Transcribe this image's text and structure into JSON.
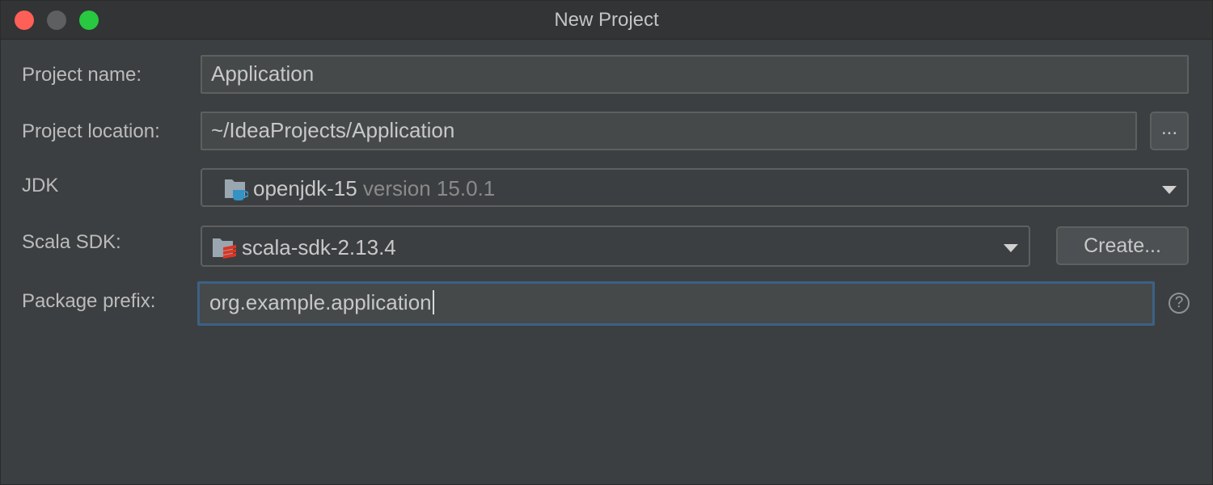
{
  "window": {
    "title": "New Project"
  },
  "form": {
    "project_name": {
      "label": "Project name:",
      "value": "Application"
    },
    "project_location": {
      "label": "Project location:",
      "value": "~/IdeaProjects/Application",
      "browse_label": "..."
    },
    "jdk": {
      "label": "JDK",
      "name": "openjdk-15",
      "version": "version 15.0.1"
    },
    "scala_sdk": {
      "label": "Scala SDK:",
      "value": "scala-sdk-2.13.4",
      "create_label": "Create..."
    },
    "package_prefix": {
      "label": "Package prefix:",
      "value": "org.example.application",
      "help_label": "?"
    }
  },
  "colors": {
    "focus_border": "#3d6185",
    "background": "#3c3f41",
    "close": "#fe5f57",
    "zoom": "#28c840"
  }
}
